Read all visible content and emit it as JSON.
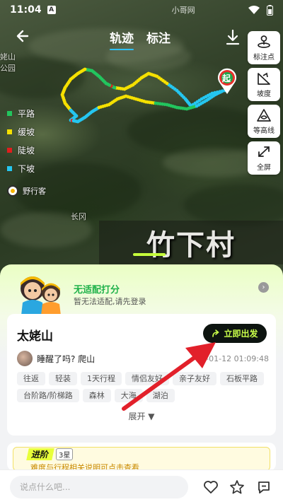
{
  "status": {
    "time": "11:04",
    "notice": "A",
    "watermark": "小哥网"
  },
  "topbar": {
    "tabs": [
      {
        "label": "轨迹",
        "active": true
      },
      {
        "label": "标注",
        "active": false
      }
    ]
  },
  "tools": [
    {
      "label": "标注点",
      "icon": "pin-marker-icon"
    },
    {
      "label": "坡度",
      "icon": "slope-icon"
    },
    {
      "label": "等高线",
      "icon": "contour-icon"
    },
    {
      "label": "全屏",
      "icon": "fullscreen-icon"
    }
  ],
  "legend": [
    {
      "label": "平路",
      "color": "#22c55e"
    },
    {
      "label": "缓坡",
      "color": "#f5e000"
    },
    {
      "label": "陡坡",
      "color": "#e11d1d"
    },
    {
      "label": "下坡",
      "color": "#25c6f0"
    }
  ],
  "map": {
    "brand": "野行客",
    "place_label": "长冈",
    "village": "竹下村",
    "corner_label_1": "姥山",
    "corner_label_2": "公园",
    "start_label": "起"
  },
  "panel": {
    "rating_title": "无适配打分",
    "rating_sub": "暂无法适配,请先登录",
    "trail_name": "太姥山",
    "go_label": "立即出发",
    "user_msg": "睡醒了吗? 爬山",
    "user_time": "6-01-12 01:09:48",
    "chips": [
      "往返",
      "轻装",
      "1天行程",
      "情侣友好",
      "亲子友好",
      "石板平路",
      "台阶路/阶梯路",
      "森林",
      "大海",
      "湖泊"
    ],
    "expand_label": "展开 ▼",
    "advanced_label": "进阶",
    "advanced_level": "3星",
    "advanced_text": "难度与行程相关说明可点击查看"
  },
  "bottombar": {
    "comment_placeholder": "说点什么吧..."
  },
  "colors": {
    "accent": "#c9ff4a",
    "rating_green": "#20b24a",
    "tab_underline": "#2fc1ff",
    "annotation_arrow": "#e2202a"
  }
}
